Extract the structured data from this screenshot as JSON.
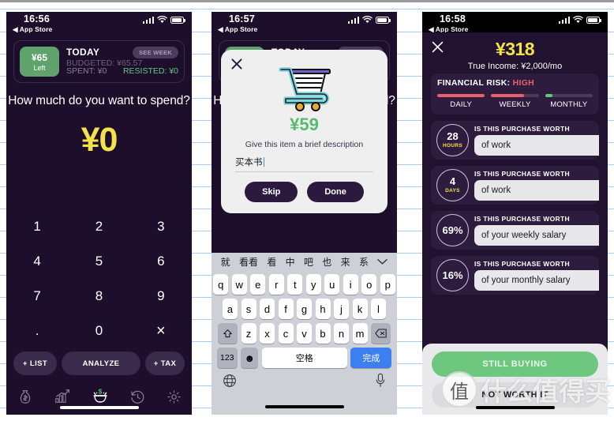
{
  "background": {
    "paper_line_color": "#a9cdf2",
    "page_color": "#ffffff"
  },
  "watermark": {
    "badge": "值",
    "text": "什么值得买"
  },
  "phone1": {
    "status": {
      "time": "16:56",
      "back_label": "App Store",
      "signal_icon": "cellular-bars-icon",
      "wifi_icon": "wifi-icon",
      "battery_icon": "battery-icon"
    },
    "budget_card": {
      "tile_amount": "¥65",
      "tile_label": "Left",
      "today_label": "TODAY",
      "budgeted": "BUDGETED: ¥65.57",
      "spent": "SPENT: ¥0",
      "resisted": "RESISTED: ¥0",
      "see_week": "SEE WEEK"
    },
    "question": "How much do you want to spend?",
    "amount": "¥0",
    "keypad": [
      "1",
      "2",
      "3",
      "4",
      "5",
      "6",
      "7",
      "8",
      "9",
      ".",
      "0",
      "×"
    ],
    "actions": {
      "list": "+ LIST",
      "analyze": "ANALYZE",
      "tax": "+ TAX"
    },
    "tabs": [
      {
        "name": "money-bag-icon",
        "label": "Budget",
        "active": false
      },
      {
        "name": "bar-chart-icon",
        "label": "Stats",
        "active": false
      },
      {
        "name": "wallet-icon",
        "label": "Spend",
        "active": true
      },
      {
        "name": "history-clock-icon",
        "label": "History",
        "active": false
      },
      {
        "name": "gear-icon",
        "label": "Settings",
        "active": false
      }
    ],
    "colors": {
      "bg": "#1d0f2b",
      "amount": "#f2e34a",
      "green": "#5fa26c",
      "resisted": "#5fc97e"
    }
  },
  "phone2": {
    "status": {
      "time": "16:57",
      "back_label": "App Store"
    },
    "behind": {
      "today_label": "TODAY",
      "see_week": "SEE WEEK"
    },
    "modal": {
      "close_icon": "close-icon",
      "cart_icon": "shopping-cart-icon",
      "price": "¥59",
      "prompt": "Give this item a brief description",
      "input_value": "买本书",
      "skip_label": "Skip",
      "done_label": "Done"
    },
    "keyboard": {
      "suggestions": [
        "就",
        "看看",
        "看",
        "中",
        "吧",
        "也",
        "来",
        "系"
      ],
      "collapse_icon": "chevron-down-icon",
      "row1": [
        "q",
        "w",
        "e",
        "r",
        "t",
        "y",
        "u",
        "i",
        "o",
        "p"
      ],
      "row2": [
        "a",
        "s",
        "d",
        "f",
        "g",
        "h",
        "j",
        "k",
        "l"
      ],
      "row3": [
        "z",
        "x",
        "c",
        "v",
        "b",
        "n",
        "m"
      ],
      "shift_icon": "shift-icon",
      "backspace_icon": "backspace-icon",
      "numeric_key": "123",
      "emoji_icon": "emoji-icon",
      "space_key": "空格",
      "done_key": "完成",
      "globe_icon": "globe-icon",
      "mic_icon": "microphone-icon"
    }
  },
  "phone3": {
    "status": {
      "time": "16:58",
      "back_label": "App Store"
    },
    "close_icon": "close-icon",
    "price": "¥318",
    "true_income": "True Income: ¥2,000/mo",
    "risk": {
      "label": "FINANCIAL RISK:",
      "level": "HIGH",
      "level_color": "#e8606a",
      "meters": [
        {
          "label": "DAILY",
          "percent": 100,
          "color": "#e8606a"
        },
        {
          "label": "WEEKLY",
          "percent": 69,
          "color": "#e8606a"
        },
        {
          "label": "MONTHLY",
          "percent": 16,
          "color": "#5fc97e"
        }
      ]
    },
    "worth_rows": [
      {
        "value": "28",
        "unit": "HOURS",
        "question": "IS THIS PURCHASE WORTH",
        "answer": "of work"
      },
      {
        "value": "4",
        "unit": "DAYS",
        "question": "IS THIS PURCHASE WORTH",
        "answer": "of work"
      },
      {
        "value": "69%",
        "unit": "",
        "question": "IS THIS PURCHASE WORTH",
        "answer": "of your weekly salary"
      },
      {
        "value": "16%",
        "unit": "",
        "question": "IS THIS PURCHASE WORTH",
        "answer": "of your monthly salary"
      }
    ],
    "footer": {
      "still_buying": "STILL BUYING",
      "not_worth": "NOT WORTH IT",
      "still_color": "#6ec77f"
    }
  }
}
